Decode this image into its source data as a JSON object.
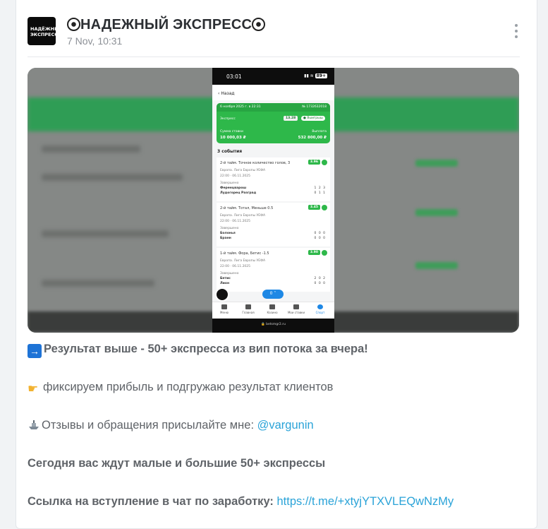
{
  "channel": {
    "name": "НАДЕЖНЫЙ ЭКСПРЕСС",
    "avatar_text": "НАДЁЖНЫЙ ЭКСПРЕСС",
    "post_date": "7 Nov, 10:31"
  },
  "screenshot": {
    "status_time": "03:01",
    "battery": "89+",
    "back_label": "Назад",
    "bet_date": "6 ноября 2025 г. в 22:31",
    "bet_id": "№ 1732632018",
    "bet_type": "Экспресс",
    "total_odds": "13.28",
    "win_badge": "Выигрыш",
    "stake_label": "Сумма ставки",
    "payout_label": "Выплата",
    "stake": "10 000,03 ₽",
    "payout": "532 800,00 ₽",
    "events_title": "3 события",
    "events": [
      {
        "title": "2-й тайм. Точное количество голов, 3",
        "odds": "3.96",
        "league": "Европа. Лига Европы УЕФА",
        "time": "22:00 · 06.11.2025",
        "status": "Завершено",
        "team1": "Ференцварош",
        "team2": "Лудогорец Разград",
        "score1": "1 2 3",
        "score2": "0 1 1"
      },
      {
        "title": "2-й тайм. Тотал, Меньше 0.5",
        "odds": "3.45",
        "league": "Европа. Лига Европы УЕФА",
        "time": "22:00 · 06.11.2025",
        "status": "Завершено",
        "team1": "Болонья",
        "team2": "Бранн",
        "score1": "0 0 0",
        "score2": "0 0 0"
      },
      {
        "title": "1-й тайм. Фора, Бетис -1.5",
        "odds": "3.90",
        "league": "Европа. Лига Европы УЕФА",
        "time": "22:00 · 06.11.2025",
        "status": "Завершено",
        "team1": "Бетис",
        "team2": "Лион",
        "score1": "2 0 2",
        "score2": "0 0 0"
      }
    ],
    "fab": "0",
    "nav": [
      "Меню",
      "Главная",
      "Казино",
      "Мои ставки",
      "Спорт"
    ],
    "url": "betsmgr2.ru"
  },
  "post": {
    "line1": "Результат выше - 50+ экспресса из вип потока за вчера!",
    "line2": "фиксируем прибыль и подгружаю результат клиентов",
    "line3_prefix": "Отзывы и обращения присылайте мне: ",
    "line3_link": "@vargunin",
    "line4": "Сегодня вас ждут малые и большие 50+ экспрессы",
    "line5_prefix": "Ссылка на вступление в чат по заработку: ",
    "line5_link": "https://t.me/+xtyjYTXVLEQwNzMy"
  }
}
